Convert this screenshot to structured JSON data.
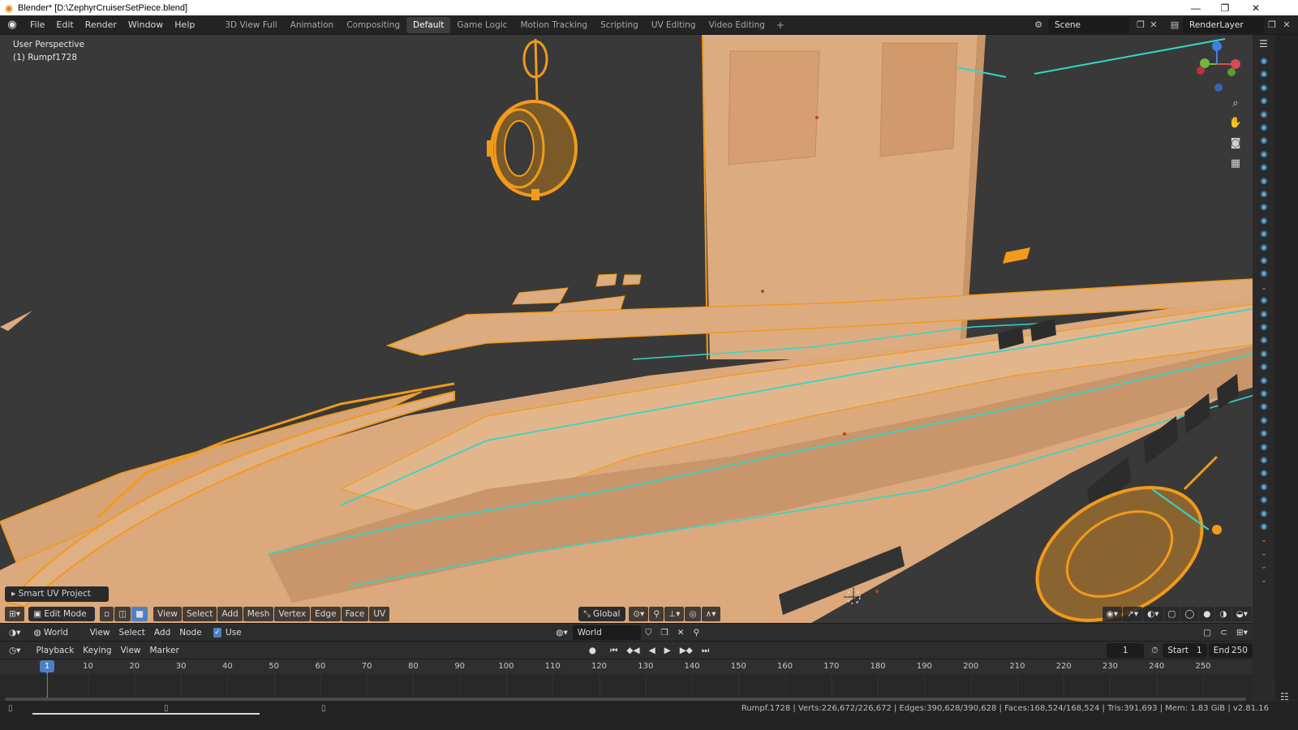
{
  "window": {
    "title": "Blender* [D:\\ZephyrCruiserSetPiece.blend]"
  },
  "menu": [
    "File",
    "Edit",
    "Render",
    "Window",
    "Help"
  ],
  "workspaces": [
    "3D View Full",
    "Animation",
    "Compositing",
    "Default",
    "Game Logic",
    "Motion Tracking",
    "Scripting",
    "UV Editing",
    "Video Editing"
  ],
  "active_workspace": "Default",
  "scene": {
    "name": "Scene",
    "render_layer": "RenderLayer"
  },
  "viewport": {
    "perspective": "User Perspective",
    "object": "(1) Rumpf1728",
    "last_operator": "Smart UV Project",
    "mode": "Edit Mode",
    "menus": [
      "View",
      "Select",
      "Add",
      "Mesh",
      "Vertex",
      "Edge",
      "Face",
      "UV"
    ],
    "transform_orientation": "Global"
  },
  "node_editor": {
    "type": "World",
    "menus": [
      "View",
      "Select",
      "Add",
      "Node"
    ],
    "use_nodes_label": "Use Nodes",
    "use_nodes": true,
    "world_name": "World"
  },
  "timeline": {
    "menus": [
      "Playback",
      "Keying",
      "View",
      "Marker"
    ],
    "current_frame": "1",
    "start_label": "Start",
    "start": "1",
    "end_label": "End",
    "end": "250",
    "ticks": [
      "1",
      "10",
      "20",
      "30",
      "40",
      "50",
      "60",
      "70",
      "80",
      "90",
      "100",
      "110",
      "120",
      "130",
      "140",
      "150",
      "160",
      "170",
      "180",
      "190",
      "200",
      "210",
      "220",
      "230",
      "240",
      "250"
    ]
  },
  "status": {
    "text": "Rumpf.1728 | Verts:226,672/226,672 | Edges:390,628/390,628 | Faces:168,524/168,524 | Tris:391,693 | Mem: 1.83 GiB | v2.81.16"
  },
  "colors": {
    "accent": "#4f7fc3",
    "mesh": "#deaa7d",
    "selection_orange": "#f29a1a",
    "seam_cyan": "#33d6c8"
  }
}
